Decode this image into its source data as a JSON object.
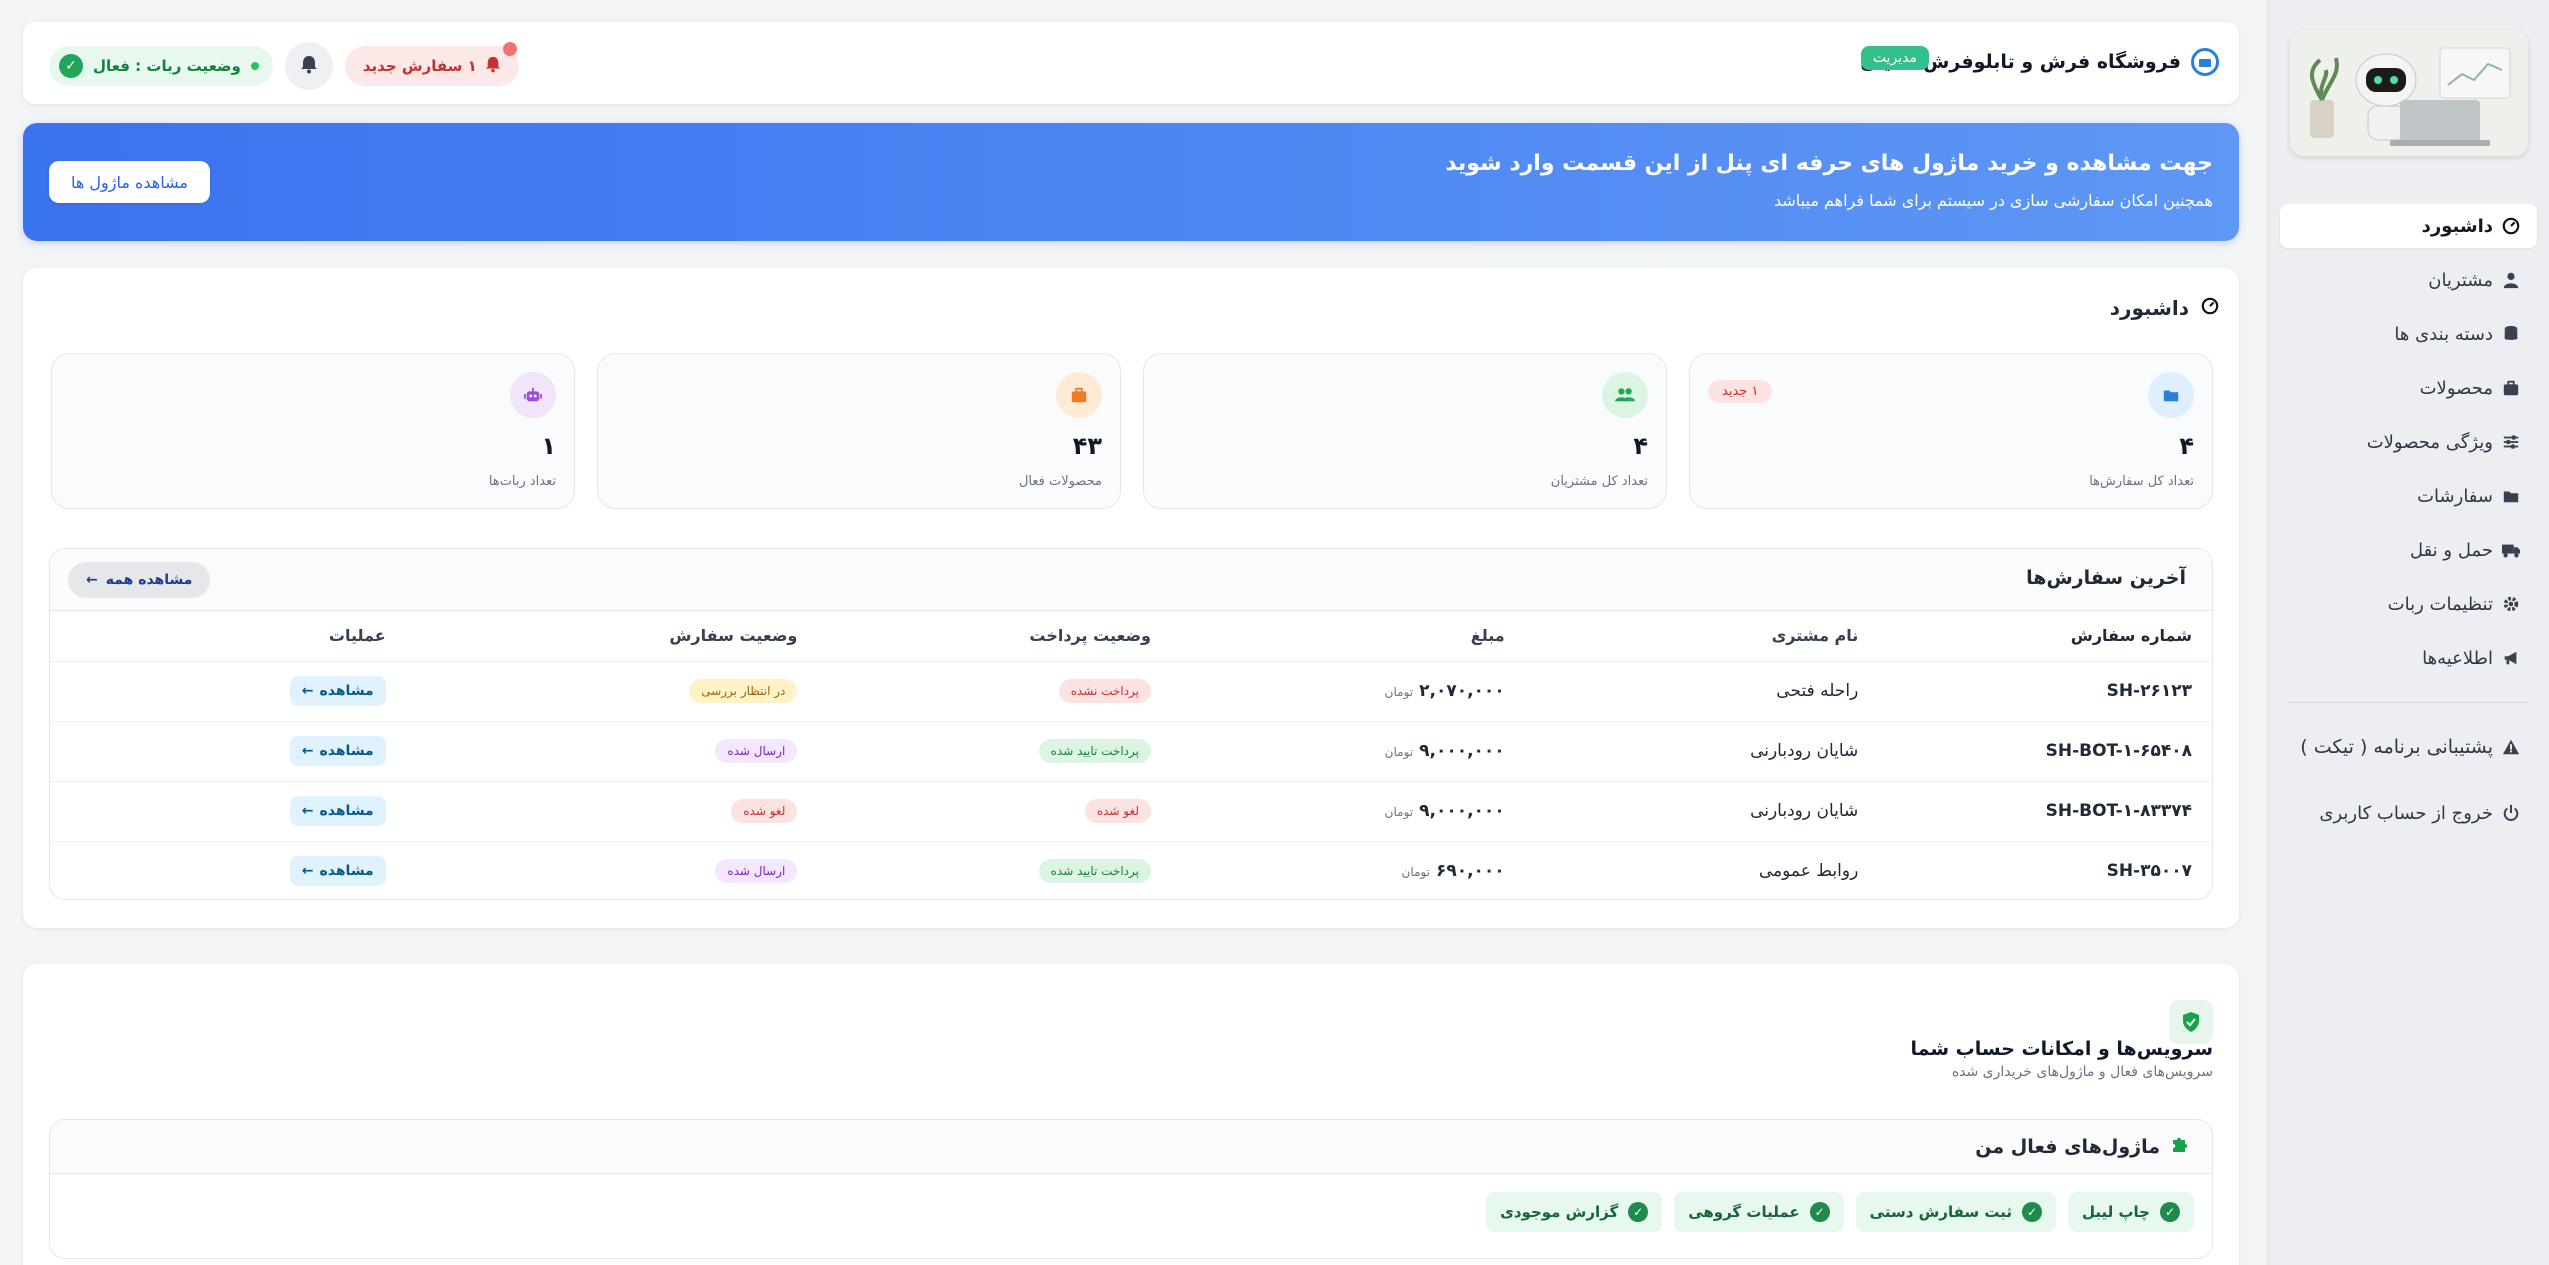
{
  "sidebar": {
    "items": [
      {
        "label": "داشبورد",
        "icon": "dashboard-icon",
        "active": true
      },
      {
        "label": "مشتریان",
        "icon": "user-icon"
      },
      {
        "label": "دسته بندی ها",
        "icon": "database-icon"
      },
      {
        "label": "محصولات",
        "icon": "briefcase-icon"
      },
      {
        "label": "ویژگی محصولات",
        "icon": "sliders-icon"
      },
      {
        "label": "سفارشات",
        "icon": "folder-icon"
      },
      {
        "label": "حمل و نقل",
        "icon": "truck-icon"
      },
      {
        "label": "تنظیمات ربات",
        "icon": "gear-icon"
      },
      {
        "label": "اطلاعیه‌ها",
        "icon": "megaphone-icon"
      }
    ],
    "support_label": "پشتیبانی برنامه ( تیکت )",
    "logout_label": "خروج از حساب کاربری"
  },
  "topbar": {
    "shop_name": "فروشگاه فرش و تابلوفرش شایان",
    "role_badge": "مدیریت",
    "new_order_label": "۱ سفارش جدید",
    "bot_status_label": "وضعیت ربات : فعال"
  },
  "banner": {
    "title": "جهت مشاهده و خرید ماژول های حرفه ای پنل از این قسمت وارد شوید",
    "subtitle": "همچنین امکان سفارشی سازی در سیستم برای شما فراهم میباشد",
    "button_label": "مشاهده ماژول ها"
  },
  "dashboard": {
    "title": "داشبورد",
    "stats": [
      {
        "value": "۴",
        "label": "تعداد کل سفارش‌ها",
        "badge": "۱ جدید",
        "icon": "folder-icon",
        "color": "#2b7fd8",
        "bg": "#e0efff"
      },
      {
        "value": "۴",
        "label": "تعداد کل مشتریان",
        "icon": "users-icon",
        "color": "#22a559",
        "bg": "#dcf5e3"
      },
      {
        "value": "۴۳",
        "label": "محصولات فعال",
        "icon": "briefcase-icon",
        "color": "#f07b24",
        "bg": "#ffead6"
      },
      {
        "value": "۱",
        "label": "تعداد ربات‌ها",
        "icon": "robot-icon",
        "color": "#9b4ddb",
        "bg": "#f1e4fb"
      }
    ]
  },
  "orders": {
    "title": "آخرین سفارش‌ها",
    "view_all_label": "مشاهده همه",
    "columns": [
      "شماره سفارش",
      "نام مشتری",
      "مبلغ",
      "وضعیت پرداخت",
      "وضعیت سفارش",
      "عملیات"
    ],
    "currency": "تومان",
    "view_label": "مشاهده",
    "rows": [
      {
        "number": "SH-۲۶۱۲۳",
        "customer": "راحله فتحی",
        "amount": "۲,۰۷۰,۰۰۰",
        "payment": "پرداخت نشده",
        "payment_kind": "red",
        "status": "در انتظار بررسی",
        "status_kind": "yellow"
      },
      {
        "number": "SH-BOT-۱-۶۵۴۰۸",
        "customer": "شایان رودبارنی",
        "amount": "۹,۰۰۰,۰۰۰",
        "payment": "پرداخت تایید شده",
        "payment_kind": "green",
        "status": "ارسال شده",
        "status_kind": "purple"
      },
      {
        "number": "SH-BOT-۱-۸۳۳۷۴",
        "customer": "شایان رودبارنی",
        "amount": "۹,۰۰۰,۰۰۰",
        "payment": "لغو شده",
        "payment_kind": "red",
        "status": "لغو شده",
        "status_kind": "red"
      },
      {
        "number": "SH-۳۵۰۰۷",
        "customer": "روابط عمومی",
        "amount": "۶۹۰,۰۰۰",
        "payment": "پرداخت تایید شده",
        "payment_kind": "green",
        "status": "ارسال شده",
        "status_kind": "purple"
      }
    ]
  },
  "services": {
    "title": "سرویس‌ها و امکانات حساب شما",
    "subtitle": "سرویس‌های فعال و ماژول‌های خریداری شده",
    "modules_title": "ماژول‌های فعال من",
    "modules": [
      "چاپ لیبل",
      "ثبت سفارش دستی",
      "عملیات گروهی",
      "گزارش موجودی"
    ]
  }
}
